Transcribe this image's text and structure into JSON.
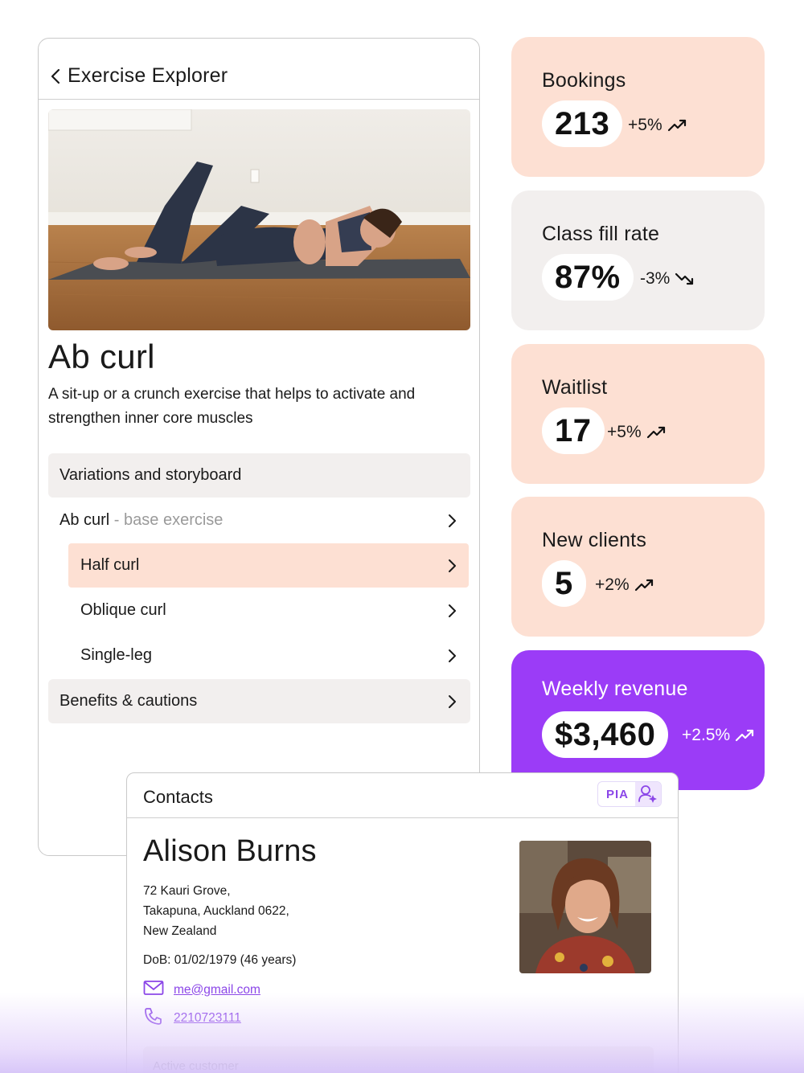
{
  "explorer": {
    "title": "Exercise Explorer",
    "exercise_name": "Ab curl",
    "description": "A sit-up or a crunch exercise that helps to activate and strengthen inner core muscles",
    "variations_header": "Variations and storyboard",
    "base_row": {
      "label": "Ab curl",
      "sub": " - base exercise"
    },
    "variations": [
      {
        "label": "Half curl",
        "selected": true
      },
      {
        "label": "Oblique curl",
        "selected": false
      },
      {
        "label": "Single-leg",
        "selected": false
      }
    ],
    "benefits_label": "Benefits & cautions"
  },
  "stats": [
    {
      "label": "Bookings",
      "value": "213",
      "change": "+5%",
      "trend": "up",
      "color": "#fde0d3"
    },
    {
      "label": "Class fill rate",
      "value": "87%",
      "change": "-3%",
      "trend": "down",
      "color": "#f2efee"
    },
    {
      "label": "Waitlist",
      "value": "17",
      "change": "+5%",
      "trend": "up",
      "color": "#fde0d3"
    },
    {
      "label": "New clients",
      "value": "5",
      "change": "+2%",
      "trend": "up",
      "color": "#fde0d3"
    },
    {
      "label": "Weekly revenue",
      "value": "$3,460",
      "change": "+2.5%",
      "trend": "up",
      "color": "#9b3cf7"
    }
  ],
  "contacts": {
    "title": "Contacts",
    "badge": "PIA",
    "name": "Alison Burns",
    "address_lines": [
      "72 Kauri Grove,",
      "Takapuna, Auckland 0622,",
      "New Zealand"
    ],
    "dob": "DoB: 01/02/1979 (46 years)",
    "email": "me@gmail.com",
    "phone": "2210723111",
    "status": "Active customer"
  },
  "icons": {
    "back": "chevron-left-icon",
    "row": "chevron-right-icon",
    "trend_up": "trend-up-icon",
    "trend_down": "trend-down-icon",
    "email": "mail-icon",
    "phone": "phone-icon",
    "pia": "user-sparkle-icon"
  },
  "colors": {
    "accent": "#9b3cf7",
    "peach": "#fde0d3",
    "neutral": "#f2efee",
    "link": "#8b46e8"
  }
}
